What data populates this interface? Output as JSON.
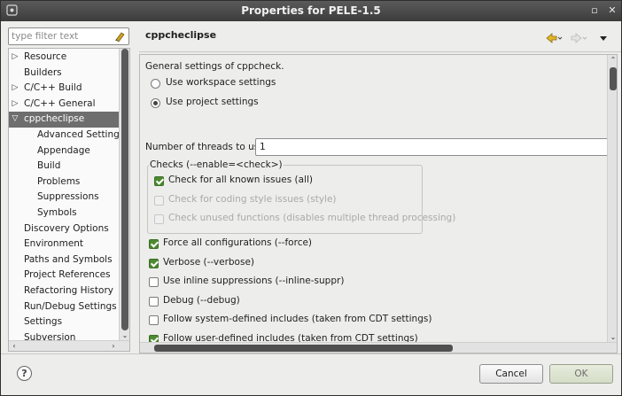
{
  "window": {
    "title": "Properties for PELE-1.5"
  },
  "filter": {
    "placeholder": "type filter text"
  },
  "tree": {
    "items": [
      {
        "label": "Resource",
        "expander": "▷",
        "child": false,
        "selected": false
      },
      {
        "label": "Builders",
        "expander": "",
        "child": false,
        "selected": false
      },
      {
        "label": "C/C++ Build",
        "expander": "▷",
        "child": false,
        "selected": false
      },
      {
        "label": "C/C++ General",
        "expander": "▷",
        "child": false,
        "selected": false
      },
      {
        "label": "cppcheclipse",
        "expander": "▽",
        "child": false,
        "selected": true
      },
      {
        "label": "Advanced Settings",
        "expander": "",
        "child": true,
        "selected": false
      },
      {
        "label": "Appendage",
        "expander": "",
        "child": true,
        "selected": false
      },
      {
        "label": "Build",
        "expander": "",
        "child": true,
        "selected": false
      },
      {
        "label": "Problems",
        "expander": "",
        "child": true,
        "selected": false
      },
      {
        "label": "Suppressions",
        "expander": "",
        "child": true,
        "selected": false
      },
      {
        "label": "Symbols",
        "expander": "",
        "child": true,
        "selected": false
      },
      {
        "label": "Discovery Options",
        "expander": "",
        "child": false,
        "selected": false
      },
      {
        "label": "Environment",
        "expander": "",
        "child": false,
        "selected": false
      },
      {
        "label": "Paths and Symbols",
        "expander": "",
        "child": false,
        "selected": false
      },
      {
        "label": "Project References",
        "expander": "",
        "child": false,
        "selected": false
      },
      {
        "label": "Refactoring History",
        "expander": "",
        "child": false,
        "selected": false
      },
      {
        "label": "Run/Debug Settings",
        "expander": "",
        "child": false,
        "selected": false
      },
      {
        "label": "Settings",
        "expander": "",
        "child": false,
        "selected": false
      },
      {
        "label": "Subversion",
        "expander": "",
        "child": false,
        "selected": false
      }
    ]
  },
  "page": {
    "title": "cppcheclipse",
    "intro": "General settings of cppcheck.",
    "radio_workspace": "Use workspace settings",
    "radio_project": "Use project settings",
    "selected_radio": "project",
    "threads_label": "Number of threads to use",
    "threads_value": "1",
    "checks_group": "Checks (--enable=<check>)",
    "checks": [
      {
        "label": "Check for all known issues (all)",
        "checked": true,
        "enabled": true
      },
      {
        "label": "Check for coding style issues (style)",
        "checked": false,
        "enabled": false
      },
      {
        "label": "Check unused functions (disables multiple thread processing)",
        "checked": false,
        "enabled": false
      }
    ],
    "options": [
      {
        "label": "Force all configurations (--force)",
        "checked": true
      },
      {
        "label": "Verbose (--verbose)",
        "checked": true
      },
      {
        "label": "Use inline suppressions (--inline-suppr)",
        "checked": false
      },
      {
        "label": "Debug (--debug)",
        "checked": false
      },
      {
        "label": "Follow system-defined includes (taken from CDT settings)",
        "checked": false
      },
      {
        "label": "Follow user-defined includes (taken from CDT settings)",
        "checked": true
      }
    ]
  },
  "buttons": {
    "help": "?",
    "cancel": "Cancel",
    "ok": "OK"
  }
}
